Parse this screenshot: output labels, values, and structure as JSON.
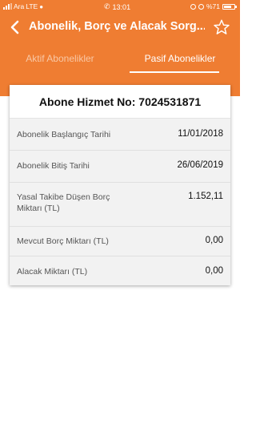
{
  "status_bar": {
    "carrier": "Ara",
    "network": "LTE",
    "time": "13:01",
    "battery": "%71",
    "battery_level": 0.71
  },
  "app_bar": {
    "title": "Abonelik, Borç ve Alacak Sorg...",
    "back_icon": "arrow-left-icon",
    "favorite_icon": "star-outline-icon"
  },
  "tabs": [
    {
      "label": "Aktif Abonelikler",
      "active": false
    },
    {
      "label": "Pasif Abonelikler",
      "active": true
    }
  ],
  "card": {
    "title": "Abone Hizmet No: 7024531871",
    "rows": [
      {
        "label": "Abonelik Başlangıç Tarihi",
        "value": "11/01/2018"
      },
      {
        "label": "Abonelik Bitiş Tarihi",
        "value": "26/06/2019"
      },
      {
        "label": "Yasal Takibe Düşen Borç Miktarı (TL)",
        "value": "1.152,11"
      },
      {
        "label": "Mevcut Borç Miktarı (TL)",
        "value": "0,00"
      },
      {
        "label": "Alacak Miktarı (TL)",
        "value": "0,00"
      }
    ]
  },
  "colors": {
    "primary": "#ef7d32",
    "tab_inactive_text": "#f9c7a4",
    "row_background": "#f2f2f2"
  }
}
